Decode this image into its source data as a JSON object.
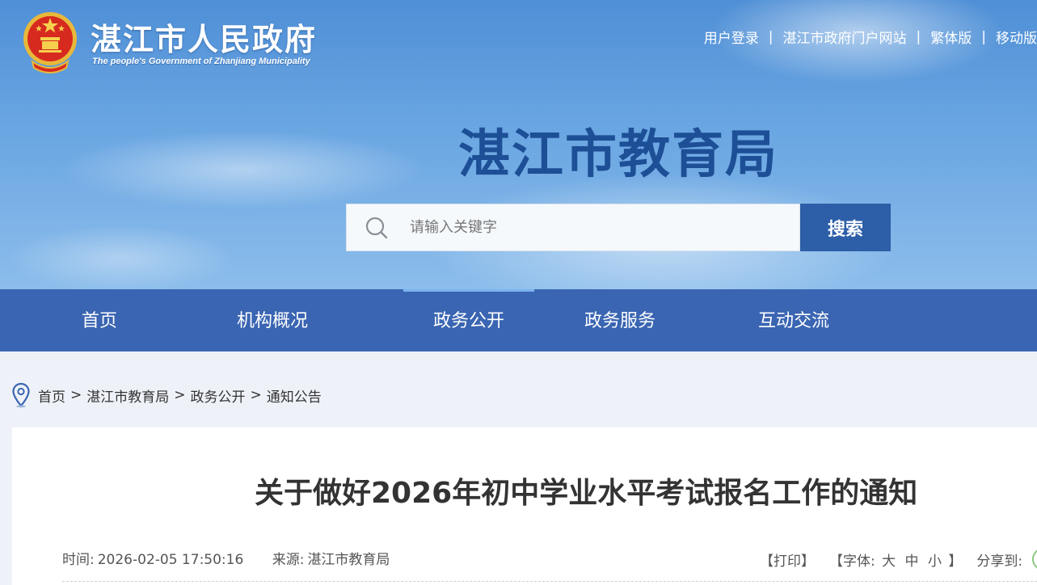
{
  "header": {
    "site_name_cn": "湛江市人民政府",
    "site_name_en": "The people's Government of Zhanjiang Municipality",
    "top_links": [
      "用户登录",
      "湛江市政府门户网站",
      "繁体版",
      "移动版"
    ],
    "separator": "|",
    "department_title": "湛江市教育局"
  },
  "search": {
    "placeholder": "请输入关键字",
    "button_label": "搜索"
  },
  "nav": {
    "items": [
      "首页",
      "机构概况",
      "政务公开",
      "政务服务",
      "互动交流"
    ],
    "active": "政务公开"
  },
  "breadcrumb": {
    "items": [
      "首页",
      "湛江市教育局",
      "政务公开",
      "通知公告"
    ],
    "separator": ">"
  },
  "article": {
    "title": "关于做好2026年初中学业水平考试报名工作的通知",
    "time_label": "时间:",
    "time_value": "2026-02-05 17:50:16",
    "source_label": "来源:",
    "source_value": "湛江市教育局",
    "print_label": "【打印】",
    "font_label": "【字体:",
    "font_sizes": [
      "大",
      "中",
      "小"
    ],
    "font_close": "】",
    "share_label": "分享到:"
  },
  "colors": {
    "nav_bg": "#3a65b2",
    "search_button": "#2d5ea8",
    "department_title": "#1d4f96"
  },
  "icons": [
    "national-emblem-icon",
    "search-icon",
    "location-pin-icon",
    "wechat-share-icon"
  ]
}
